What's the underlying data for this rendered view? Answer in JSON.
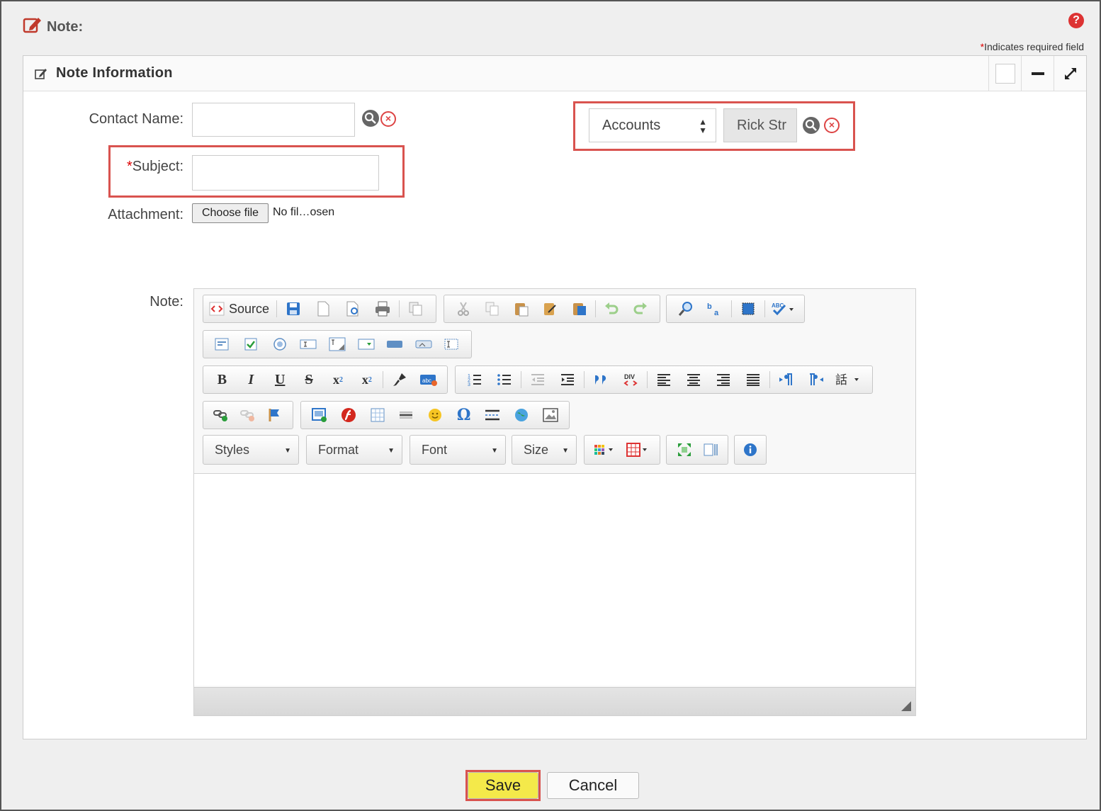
{
  "header": {
    "title": "Note:",
    "required_note_star": "*",
    "required_note": "Indicates required field"
  },
  "panel": {
    "title": "Note Information"
  },
  "form": {
    "contact_label": "Contact Name:",
    "subject_star": "*",
    "subject_label": "Subject:",
    "attachment_label": "Attachment:",
    "choose_file": "Choose file",
    "file_status": "No fil…osen",
    "note_label": "Note:",
    "related_select": "Accounts",
    "related_value": "Rick Str"
  },
  "editor": {
    "source_label": "Source",
    "combos": {
      "styles": "Styles",
      "format": "Format",
      "font": "Font",
      "size": "Size"
    }
  },
  "actions": {
    "save": "Save",
    "cancel": "Cancel"
  }
}
